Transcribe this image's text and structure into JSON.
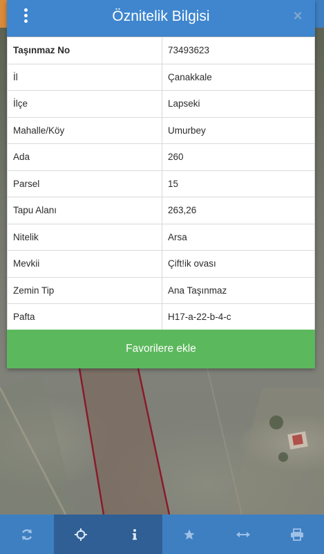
{
  "dialog": {
    "title": "Öznitelik Bilgisi",
    "close_symbol": "×",
    "rows": [
      {
        "key": "Taşınmaz No",
        "value": "73493623"
      },
      {
        "key": "İl",
        "value": "Çanakkale"
      },
      {
        "key": "İlçe",
        "value": "Lapseki"
      },
      {
        "key": "Mahalle/Köy",
        "value": "Umurbey"
      },
      {
        "key": "Ada",
        "value": "260"
      },
      {
        "key": "Parsel",
        "value": "15"
      },
      {
        "key": "Tapu Alanı",
        "value": "263,26"
      },
      {
        "key": "Nitelik",
        "value": "Arsa"
      },
      {
        "key": "Mevkii",
        "value": "Çift!ik ovası"
      },
      {
        "key": "Zemin Tip",
        "value": "Ana Taşınmaz"
      },
      {
        "key": "Pafta",
        "value": "H17-a-22-b-4-c"
      }
    ],
    "favorite_button": "Favorilere ekle"
  },
  "toolbar": {
    "items": [
      {
        "icon": "refresh-icon",
        "active": false
      },
      {
        "icon": "crosshair-icon",
        "active": true
      },
      {
        "icon": "info-icon",
        "active": true
      },
      {
        "icon": "star-icon",
        "active": false
      },
      {
        "icon": "horizontal-arrows-icon",
        "active": false
      },
      {
        "icon": "print-icon",
        "active": false
      }
    ]
  },
  "colors": {
    "header_blue": "#3f86cf",
    "toolbar_blue": "#3e7fc2",
    "toolbar_active": "#2f5f95",
    "favorite_green": "#5cb85c",
    "parcel_border": "#8b1a2a"
  }
}
